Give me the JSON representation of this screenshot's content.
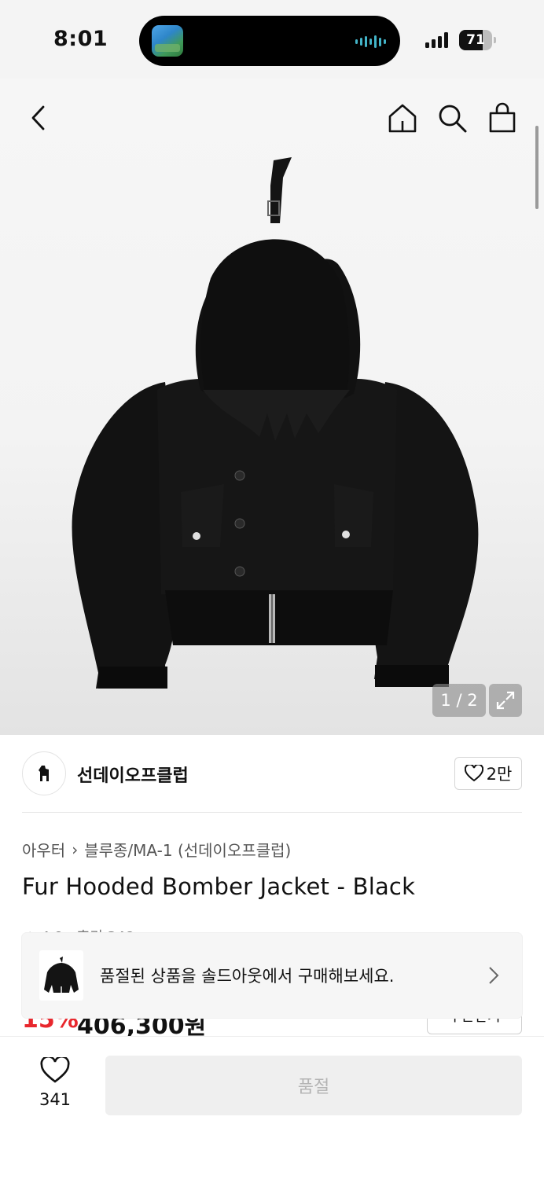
{
  "status_bar": {
    "time": "8:01",
    "battery_level": "71",
    "battery_fraction": 0.71
  },
  "gallery": {
    "counter": "1 / 2",
    "current": 1,
    "total": 2
  },
  "brand": {
    "name": "선데이오프클럽",
    "likes": "2만"
  },
  "product": {
    "breadcrumb": [
      "아우터",
      "블루종/MA-1 (선데이오프클럽)"
    ],
    "title": "Fur Hooded Bomber Jacket - Black",
    "rating_peek": "★ 4.9 · 후기 348",
    "discount": "15%",
    "price": "406,300원",
    "coupon_label": "쿠폰받기"
  },
  "toast": {
    "message": "품절된 상품을 솔드아웃에서 구매해보세요."
  },
  "bottom_bar": {
    "wish_count": "341",
    "cta_label": "품절"
  },
  "colors": {
    "discount_red": "#e8272d",
    "disabled_gray": "#efefef",
    "battery_empty": "#bdbdbd"
  },
  "icons": [
    "back-chevron-icon",
    "home-icon",
    "search-icon",
    "shopping-bag-icon",
    "expand-icon",
    "heart-icon",
    "chevron-right-icon",
    "brand-logo-icon"
  ]
}
